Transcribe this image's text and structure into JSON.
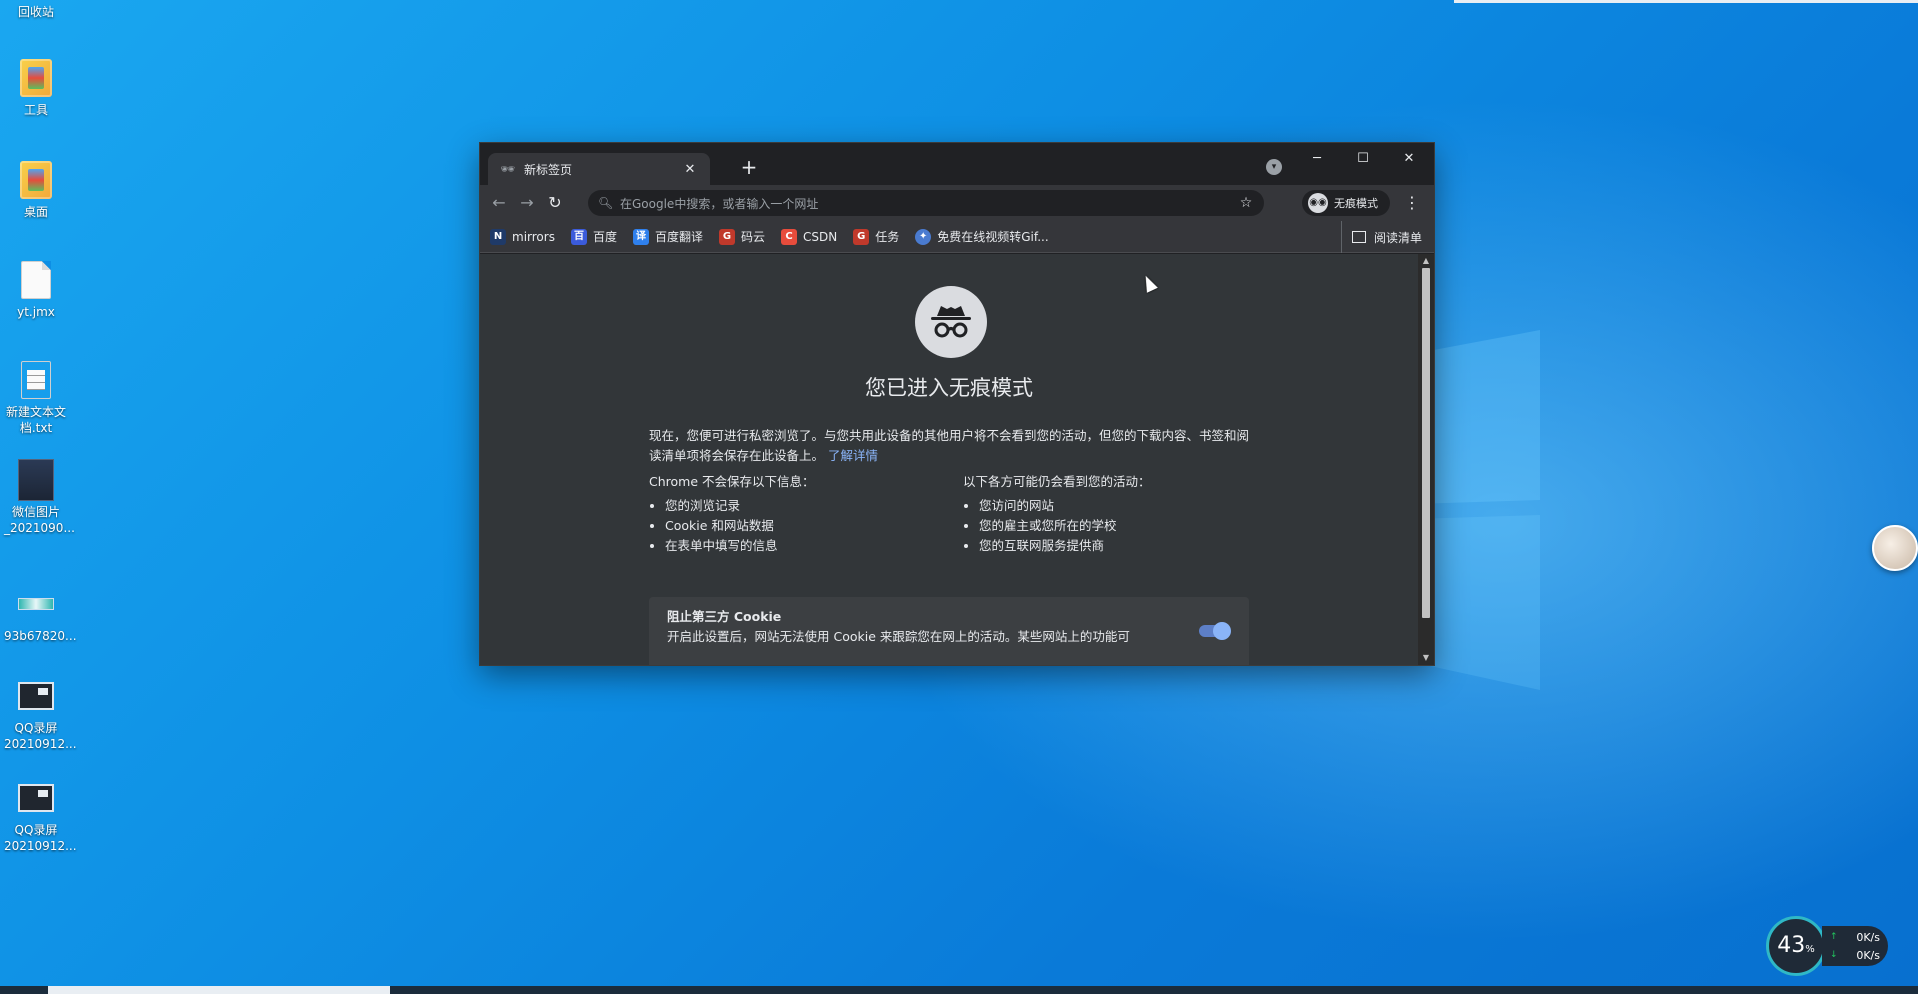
{
  "desktop": {
    "icons": [
      {
        "label": "回收站"
      },
      {
        "label": "工具"
      },
      {
        "label": "桌面"
      },
      {
        "label": "yt.jmx"
      },
      {
        "label": "新建文本文档.txt"
      },
      {
        "label": "微信图片_2021090..."
      },
      {
        "label": "93b67820..."
      },
      {
        "label": "QQ录屏20210912..."
      },
      {
        "label": "QQ录屏20210912..."
      }
    ]
  },
  "browser": {
    "tab": {
      "title": "新标签页"
    },
    "omnibox": {
      "placeholder": "在Google中搜索，或者输入一个网址"
    },
    "profile_chip": "无痕模式",
    "bookmarks": [
      {
        "label": "mirrors",
        "icon": "N",
        "color": "#1f3a68"
      },
      {
        "label": "百度",
        "icon": "百",
        "color": "#3b5bdb"
      },
      {
        "label": "百度翻译",
        "icon": "译",
        "color": "#2f80ed"
      },
      {
        "label": "码云",
        "icon": "G",
        "color": "#c0392b"
      },
      {
        "label": "CSDN",
        "icon": "C",
        "color": "#e74c3c"
      },
      {
        "label": "任务",
        "icon": "G",
        "color": "#c0392b"
      },
      {
        "label": "免费在线视频转Gif...",
        "icon": "✦",
        "color": "#4a7bd0"
      }
    ],
    "reading_list": "阅读清单",
    "page": {
      "heading": "您已进入无痕模式",
      "intro": "现在，您便可进行私密浏览了。与您共用此设备的其他用户将不会看到您的活动，但您的下载内容、书签和阅读清单项将会保存在此设备上。",
      "learn_more": "了解详情",
      "left_title": "Chrome 不会保存以下信息：",
      "left_items": [
        "您的浏览记录",
        "Cookie 和网站数据",
        "在表单中填写的信息"
      ],
      "right_title": "以下各方可能仍会看到您的活动：",
      "right_items": [
        "您访问的网站",
        "您的雇主或您所在的学校",
        "您的互联网服务提供商"
      ],
      "cookie_title": "阻止第三方 Cookie",
      "cookie_desc": "开启此设置后，网站无法使用 Cookie 来跟踪您在网上的活动。某些网站上的功能可"
    }
  },
  "monitor": {
    "percent": "43",
    "percent_unit": "%",
    "upload": "0K/s",
    "download": "0K/s"
  }
}
